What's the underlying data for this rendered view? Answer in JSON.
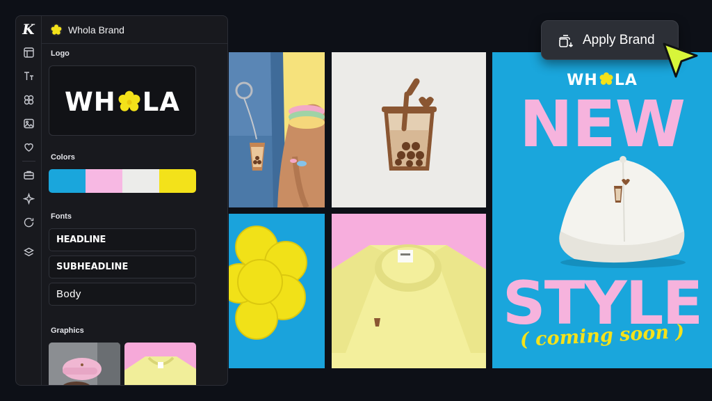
{
  "app": {
    "logo_letter": "K"
  },
  "panel": {
    "brand_name": "Whola Brand",
    "sections": {
      "logo": "Logo",
      "colors": "Colors",
      "fonts": "Fonts",
      "graphics": "Graphics"
    },
    "logo_text_left": "WH",
    "logo_text_right": "LA",
    "colors": [
      "#1aa6dc",
      "#f7b8e3",
      "#ececea",
      "#f3e21a"
    ],
    "fonts": {
      "headline": "HEADLINE",
      "subheadline": "SUBHEADLINE",
      "body": "Body"
    },
    "rail_icons": [
      "layout-icon",
      "text-icon",
      "elements-icon",
      "image-icon",
      "heart-icon",
      "briefcase-icon",
      "sparkle-icon",
      "chat-icon",
      "layers-icon"
    ]
  },
  "apply_button": {
    "label": "Apply Brand"
  },
  "poster": {
    "brand_left": "WH",
    "brand_right": "LA",
    "headline_top": "NEW",
    "headline_bottom": "STYLE",
    "tagline": "( coming soon )"
  },
  "palette": {
    "blue": "#1aa6dc",
    "pink": "#f7b8e3",
    "yellow": "#f3e21a",
    "cursor": "#d7f53a"
  }
}
